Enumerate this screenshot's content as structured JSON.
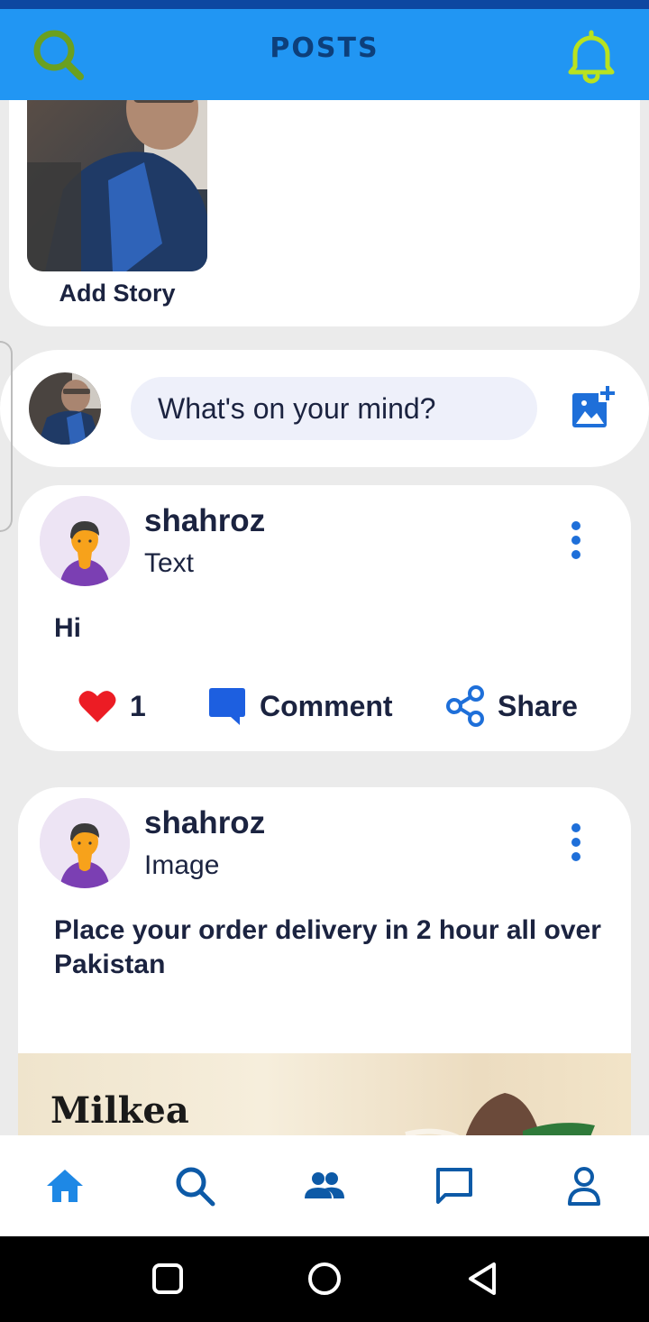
{
  "app": {
    "title": "POSTS"
  },
  "colors": {
    "appbar": "#2196f3",
    "accent": "#1e6fd9",
    "icon_green": "#8bc34a",
    "like_red": "#ec1c24"
  },
  "header": {
    "search_icon": "search-icon",
    "notification_icon": "bell-icon"
  },
  "stories": {
    "add_label": "Add Story"
  },
  "composer": {
    "placeholder": "What's on your mind?",
    "photo_icon": "add-photo-icon"
  },
  "posts": [
    {
      "author": "shahroz",
      "type": "Text",
      "body": "Hi",
      "likes": "1",
      "comment_label": "Comment",
      "share_label": "Share"
    },
    {
      "author": "shahroz",
      "type": "Image",
      "body": "Place your order delivery in 2 hour all over Pakistan",
      "image_brand": "Milkea"
    }
  ],
  "bottom_nav": {
    "items": [
      "home-icon",
      "search-icon",
      "people-icon",
      "chat-icon",
      "profile-icon"
    ],
    "active": "home-icon"
  },
  "system_nav": [
    "recents-button",
    "home-button",
    "back-button"
  ]
}
